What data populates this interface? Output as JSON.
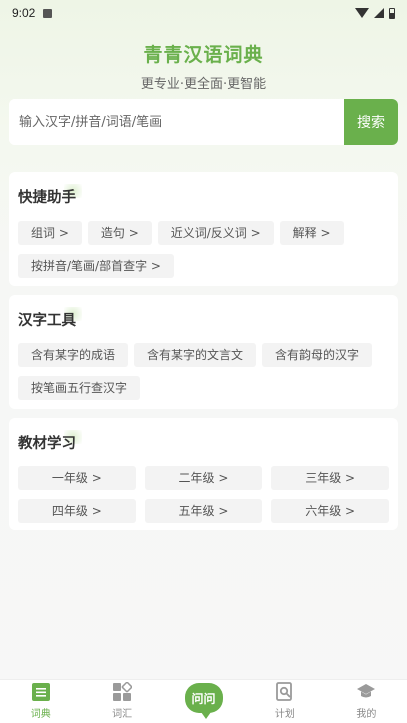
{
  "status_bar": {
    "time": "9:02"
  },
  "header": {
    "title": "青青汉语词典",
    "subtitle": "更专业·更全面·更智能"
  },
  "search": {
    "placeholder": "输入汉字/拼音/词语/笔画",
    "value": "",
    "button_label": "搜索"
  },
  "quick_helper": {
    "title": "快捷助手",
    "items": [
      "组词 >",
      "造句 >",
      "近义词/反义词 >",
      "解释 >",
      "按拼音/笔画/部首查字 >"
    ]
  },
  "hanzi_tools": {
    "title": "汉字工具",
    "items": [
      "含有某字的成语",
      "含有某字的文言文",
      "含有韵母的汉字",
      "按笔画五行查汉字"
    ]
  },
  "textbook": {
    "title": "教材学习",
    "grades": [
      "一年级 >",
      "二年级 >",
      "三年级 >",
      "四年级 >",
      "五年级 >",
      "六年级 >"
    ]
  },
  "nav": {
    "items": [
      {
        "label": "词典",
        "icon": "dictionary-icon",
        "active": true
      },
      {
        "label": "词汇",
        "icon": "vocabulary-grid-icon",
        "active": false
      },
      {
        "label": "问问",
        "icon": "ask-bubble-icon",
        "active": false
      },
      {
        "label": "计划",
        "icon": "plan-search-icon",
        "active": false
      },
      {
        "label": "我的",
        "icon": "graduation-cap-icon",
        "active": false
      }
    ]
  },
  "colors": {
    "accent": "#6ab04c",
    "chip_bg": "#f3f3f3"
  }
}
